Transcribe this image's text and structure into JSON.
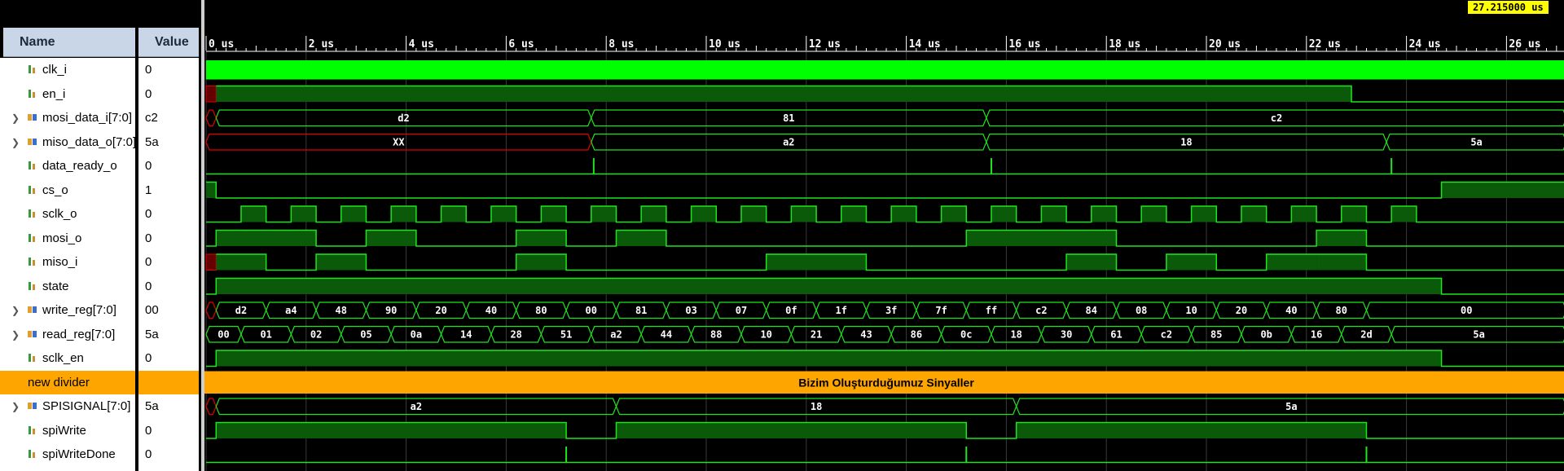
{
  "columns": {
    "name": "Name",
    "value": "Value"
  },
  "cursor": {
    "time_label": "27.215000 us"
  },
  "timescale": {
    "end_us": 27.0,
    "ticks": [
      "0 us",
      "2 us",
      "4 us",
      "6 us",
      "8 us",
      "10 us",
      "12 us",
      "14 us",
      "16 us",
      "18 us",
      "20 us",
      "22 us",
      "24 us",
      "26 us"
    ]
  },
  "colors": {
    "wave": "#1fe31f",
    "wave_fill": "#0a5a0a",
    "clk_fill": "#00ff00",
    "undefined": "#e00000",
    "divider": "#ffa500",
    "grid": "#3a3a3a"
  },
  "signals": [
    {
      "name": "clk_i",
      "value": "0",
      "kind": "clock",
      "icon": "logic-signal-icon"
    },
    {
      "name": "en_i",
      "value": "0",
      "kind": "bit",
      "icon": "logic-signal-icon",
      "segments": [
        [
          0,
          0.2,
          "X"
        ],
        [
          0.2,
          22.9,
          1
        ],
        [
          22.9,
          27.2,
          0
        ]
      ]
    },
    {
      "name": "mosi_data_i[7:0]",
      "value": "c2",
      "kind": "bus",
      "expandable": true,
      "icon": "bus-signal-icon",
      "segments": [
        [
          0,
          0.2,
          "X"
        ],
        [
          0.2,
          7.7,
          "d2"
        ],
        [
          7.7,
          15.6,
          "81"
        ],
        [
          15.6,
          27.2,
          "c2"
        ]
      ]
    },
    {
      "name": "miso_data_o[7:0]",
      "value": "5a",
      "kind": "bus",
      "expandable": true,
      "icon": "bus-signal-icon",
      "segments": [
        [
          0,
          7.7,
          "XX"
        ],
        [
          7.7,
          15.6,
          "a2"
        ],
        [
          15.6,
          23.6,
          "18"
        ],
        [
          23.6,
          27.2,
          "5a"
        ]
      ]
    },
    {
      "name": "data_ready_o",
      "value": "0",
      "kind": "bit",
      "icon": "logic-signal-icon",
      "pulses": [
        7.75,
        15.7,
        23.7
      ]
    },
    {
      "name": "cs_o",
      "value": "1",
      "kind": "bit",
      "icon": "logic-signal-icon",
      "segments": [
        [
          0,
          0.2,
          1
        ],
        [
          0.2,
          24.7,
          0
        ],
        [
          24.7,
          27.2,
          1
        ]
      ]
    },
    {
      "name": "sclk_o",
      "value": "0",
      "kind": "bit",
      "icon": "logic-signal-icon",
      "segments": [
        [
          0,
          0.7,
          0
        ],
        [
          0.7,
          1.2,
          1
        ],
        [
          1.2,
          1.7,
          0
        ],
        [
          1.7,
          2.2,
          1
        ],
        [
          2.2,
          2.7,
          0
        ],
        [
          2.7,
          3.2,
          1
        ],
        [
          3.2,
          3.7,
          0
        ],
        [
          3.7,
          4.2,
          1
        ],
        [
          4.2,
          4.7,
          0
        ],
        [
          4.7,
          5.2,
          1
        ],
        [
          5.2,
          5.7,
          0
        ],
        [
          5.7,
          6.2,
          1
        ],
        [
          6.2,
          6.7,
          0
        ],
        [
          6.7,
          7.2,
          1
        ],
        [
          7.2,
          7.7,
          0
        ],
        [
          7.7,
          8.2,
          1
        ],
        [
          8.2,
          8.7,
          0
        ],
        [
          8.7,
          9.2,
          1
        ],
        [
          9.2,
          9.7,
          0
        ],
        [
          9.7,
          10.2,
          1
        ],
        [
          10.2,
          10.7,
          0
        ],
        [
          10.7,
          11.2,
          1
        ],
        [
          11.2,
          11.7,
          0
        ],
        [
          11.7,
          12.2,
          1
        ],
        [
          12.2,
          12.7,
          0
        ],
        [
          12.7,
          13.2,
          1
        ],
        [
          13.2,
          13.7,
          0
        ],
        [
          13.7,
          14.2,
          1
        ],
        [
          14.2,
          14.7,
          0
        ],
        [
          14.7,
          15.2,
          1
        ],
        [
          15.2,
          15.7,
          0
        ],
        [
          15.7,
          16.2,
          1
        ],
        [
          16.2,
          16.7,
          0
        ],
        [
          16.7,
          17.2,
          1
        ],
        [
          17.2,
          17.7,
          0
        ],
        [
          17.7,
          18.2,
          1
        ],
        [
          18.2,
          18.7,
          0
        ],
        [
          18.7,
          19.2,
          1
        ],
        [
          19.2,
          19.7,
          0
        ],
        [
          19.7,
          20.2,
          1
        ],
        [
          20.2,
          20.7,
          0
        ],
        [
          20.7,
          21.2,
          1
        ],
        [
          21.2,
          21.7,
          0
        ],
        [
          21.7,
          22.2,
          1
        ],
        [
          22.2,
          22.7,
          0
        ],
        [
          22.7,
          23.2,
          1
        ],
        [
          23.2,
          23.7,
          0
        ],
        [
          23.7,
          24.2,
          1
        ],
        [
          24.2,
          27.2,
          0
        ]
      ]
    },
    {
      "name": "mosi_o",
      "value": "0",
      "kind": "bit",
      "icon": "logic-signal-icon",
      "segments": [
        [
          0,
          0.2,
          0
        ],
        [
          0.2,
          2.2,
          1
        ],
        [
          2.2,
          3.2,
          0
        ],
        [
          3.2,
          4.2,
          1
        ],
        [
          4.2,
          6.2,
          0
        ],
        [
          6.2,
          7.2,
          1
        ],
        [
          7.2,
          8.2,
          0
        ],
        [
          8.2,
          9.2,
          1
        ],
        [
          9.2,
          15.2,
          0
        ],
        [
          15.2,
          18.2,
          1
        ],
        [
          18.2,
          22.2,
          0
        ],
        [
          22.2,
          23.2,
          1
        ],
        [
          23.2,
          27.2,
          0
        ]
      ]
    },
    {
      "name": "miso_i",
      "value": "0",
      "kind": "bit",
      "icon": "logic-signal-icon",
      "segments": [
        [
          0,
          0.2,
          "X"
        ],
        [
          0.2,
          1.2,
          1
        ],
        [
          1.2,
          2.2,
          0
        ],
        [
          2.2,
          3.2,
          1
        ],
        [
          3.2,
          6.2,
          0
        ],
        [
          6.2,
          7.2,
          1
        ],
        [
          7.2,
          11.2,
          0
        ],
        [
          11.2,
          13.2,
          1
        ],
        [
          13.2,
          17.2,
          0
        ],
        [
          17.2,
          18.2,
          1
        ],
        [
          18.2,
          19.2,
          0
        ],
        [
          19.2,
          20.2,
          1
        ],
        [
          20.2,
          21.2,
          0
        ],
        [
          21.2,
          22.2,
          1
        ],
        [
          22.2,
          23.2,
          1
        ],
        [
          23.2,
          27.2,
          0
        ]
      ]
    },
    {
      "name": "state",
      "value": "0",
      "kind": "bit",
      "icon": "logic-signal-icon",
      "segments": [
        [
          0,
          0.2,
          0
        ],
        [
          0.2,
          24.7,
          1
        ],
        [
          24.7,
          27.2,
          0
        ]
      ]
    },
    {
      "name": "write_reg[7:0]",
      "value": "00",
      "kind": "bus",
      "expandable": true,
      "icon": "bus-signal-icon",
      "segments": [
        [
          0,
          0.2,
          "X"
        ],
        [
          0.2,
          1.2,
          "d2"
        ],
        [
          1.2,
          2.2,
          "a4"
        ],
        [
          2.2,
          3.2,
          "48"
        ],
        [
          3.2,
          4.2,
          "90"
        ],
        [
          4.2,
          5.2,
          "20"
        ],
        [
          5.2,
          6.2,
          "40"
        ],
        [
          6.2,
          7.2,
          "80"
        ],
        [
          7.2,
          8.2,
          "00"
        ],
        [
          8.2,
          9.2,
          "81"
        ],
        [
          9.2,
          10.2,
          "03"
        ],
        [
          10.2,
          11.2,
          "07"
        ],
        [
          11.2,
          12.2,
          "0f"
        ],
        [
          12.2,
          13.2,
          "1f"
        ],
        [
          13.2,
          14.2,
          "3f"
        ],
        [
          14.2,
          15.2,
          "7f"
        ],
        [
          15.2,
          16.2,
          "ff"
        ],
        [
          16.2,
          17.2,
          "c2"
        ],
        [
          17.2,
          18.2,
          "84"
        ],
        [
          18.2,
          19.2,
          "08"
        ],
        [
          19.2,
          20.2,
          "10"
        ],
        [
          20.2,
          21.2,
          "20"
        ],
        [
          21.2,
          22.2,
          "40"
        ],
        [
          22.2,
          23.2,
          "80"
        ],
        [
          23.2,
          27.2,
          "00"
        ]
      ]
    },
    {
      "name": "read_reg[7:0]",
      "value": "5a",
      "kind": "bus",
      "expandable": true,
      "icon": "bus-signal-icon",
      "segments": [
        [
          0,
          0.7,
          "00"
        ],
        [
          0.7,
          1.7,
          "01"
        ],
        [
          1.7,
          2.7,
          "02"
        ],
        [
          2.7,
          3.7,
          "05"
        ],
        [
          3.7,
          4.7,
          "0a"
        ],
        [
          4.7,
          5.7,
          "14"
        ],
        [
          5.7,
          6.7,
          "28"
        ],
        [
          6.7,
          7.7,
          "51"
        ],
        [
          7.7,
          8.7,
          "a2"
        ],
        [
          8.7,
          9.7,
          "44"
        ],
        [
          9.7,
          10.7,
          "88"
        ],
        [
          10.7,
          11.7,
          "10"
        ],
        [
          11.7,
          12.7,
          "21"
        ],
        [
          12.7,
          13.7,
          "43"
        ],
        [
          13.7,
          14.7,
          "86"
        ],
        [
          14.7,
          15.7,
          "0c"
        ],
        [
          15.7,
          16.7,
          "18"
        ],
        [
          16.7,
          17.7,
          "30"
        ],
        [
          17.7,
          18.7,
          "61"
        ],
        [
          18.7,
          19.7,
          "c2"
        ],
        [
          19.7,
          20.7,
          "85"
        ],
        [
          20.7,
          21.7,
          "0b"
        ],
        [
          21.7,
          22.7,
          "16"
        ],
        [
          22.7,
          23.7,
          "2d"
        ],
        [
          23.7,
          27.2,
          "5a"
        ]
      ]
    },
    {
      "name": "sclk_en",
      "value": "0",
      "kind": "bit",
      "icon": "logic-signal-icon",
      "segments": [
        [
          0,
          0.2,
          0
        ],
        [
          0.2,
          24.7,
          1
        ],
        [
          24.7,
          27.2,
          0
        ]
      ]
    },
    {
      "name": "new divider",
      "value": "",
      "kind": "divider",
      "label": "Bizim Oluşturduğumuz Sinyaller"
    },
    {
      "name": "SPISIGNAL[7:0]",
      "value": "5a",
      "kind": "bus",
      "expandable": true,
      "icon": "bus-signal-icon",
      "segments": [
        [
          0,
          0.2,
          "X"
        ],
        [
          0.2,
          8.2,
          "a2"
        ],
        [
          8.2,
          16.2,
          "18"
        ],
        [
          16.2,
          27.2,
          "5a"
        ]
      ]
    },
    {
      "name": "spiWrite",
      "value": "0",
      "kind": "bit",
      "icon": "logic-signal-icon",
      "segments": [
        [
          0,
          0.2,
          0
        ],
        [
          0.2,
          7.2,
          1
        ],
        [
          7.2,
          8.2,
          0
        ],
        [
          8.2,
          15.2,
          1
        ],
        [
          15.2,
          16.2,
          0
        ],
        [
          16.2,
          23.2,
          1
        ],
        [
          23.2,
          27.2,
          0
        ]
      ]
    },
    {
      "name": "spiWriteDone",
      "value": "0",
      "kind": "bit",
      "icon": "logic-signal-icon",
      "pulses": [
        7.2,
        15.2,
        23.2
      ]
    }
  ]
}
